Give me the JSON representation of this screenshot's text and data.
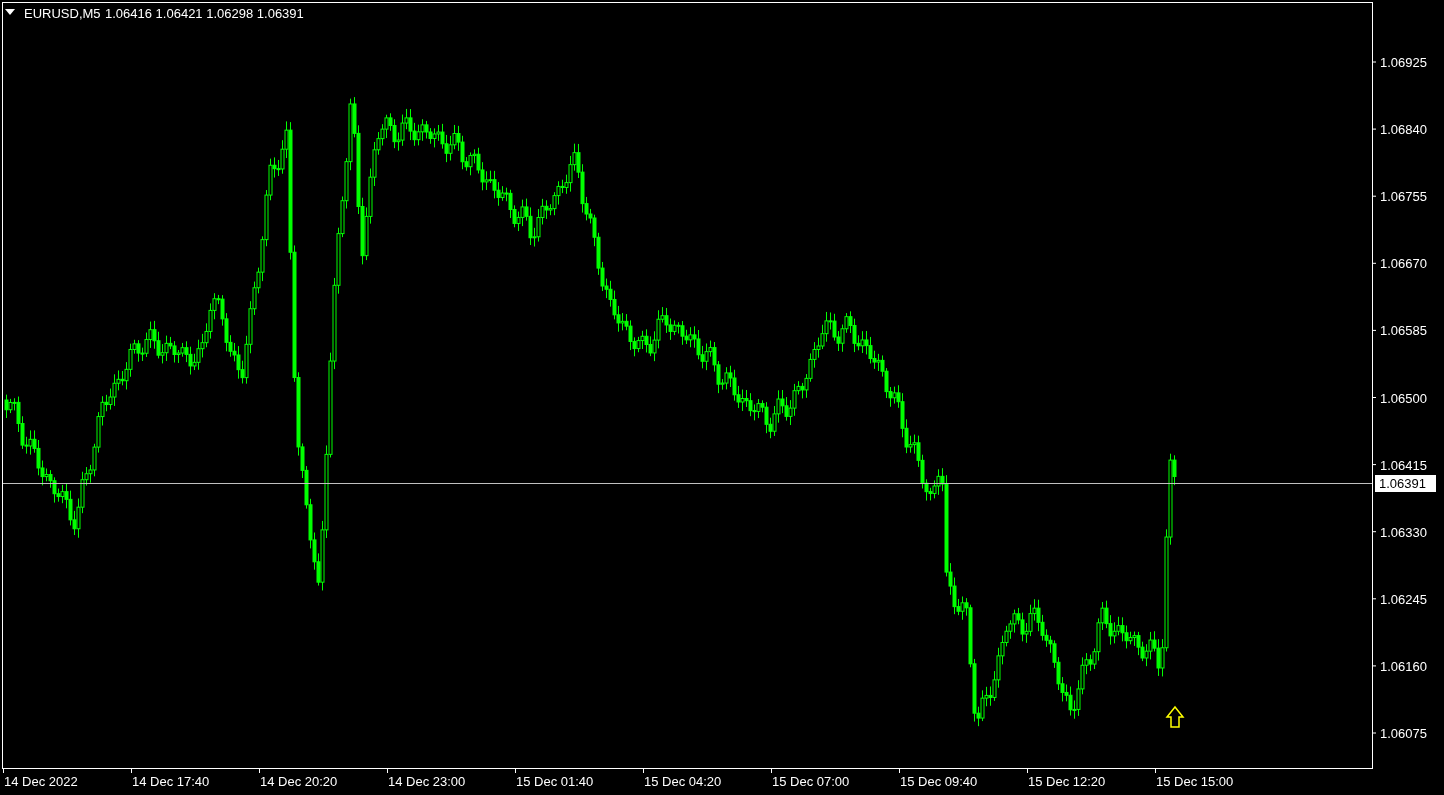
{
  "chart": {
    "symbol": "EURUSD,M5",
    "ohlc": "1.06416 1.06421 1.06298 1.06391",
    "price_labels": [
      "1.06925",
      "1.06840",
      "1.06755",
      "1.06670",
      "1.06585",
      "1.06500",
      "1.06415",
      "1.06330",
      "1.06245",
      "1.06160",
      "1.06075"
    ],
    "current_price": "1.06391",
    "time_labels": [
      "14 Dec 2022",
      "14 Dec 17:40",
      "14 Dec 20:20",
      "14 Dec 23:00",
      "15 Dec 01:40",
      "15 Dec 04:20",
      "15 Dec 07:00",
      "15 Dec 09:40",
      "15 Dec 12:20",
      "15 Dec 15:00"
    ]
  }
}
